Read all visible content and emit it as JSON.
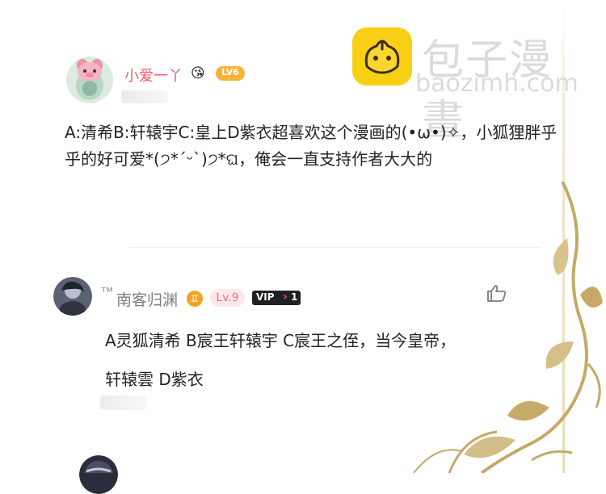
{
  "watermark": {
    "name": "包子漫畫",
    "domain": "baozimh.com"
  },
  "comments": [
    {
      "username": "小爱一丫",
      "emoji": "😘",
      "level_badge": "LV6",
      "text": "A:清希B:轩辕宇C:皇上D紫衣超喜欢这个漫画的(•ω•)✧，小狐狸胖乎乎的好可爱*(੭*ˊᵕˋ)੭*ଘ，俺会一直支持作者大大的"
    },
    {
      "name_prefix": "ᴛᴍ",
      "username": "南客归渊",
      "zodiac": "♊",
      "level_badge": "Lv.9",
      "vip": {
        "label": "VIP",
        "level": "1"
      },
      "text_lines": [
        "A灵狐清希 B宸王轩辕宇 C宸王之侄，当今皇帝，",
        "轩辕雲 D紫衣"
      ],
      "like_icon": "thumbs-up-outline"
    }
  ],
  "colors": {
    "pink_username": "#ef5b6c",
    "gold_ornament": "#c6a967",
    "brand_yellow": "#f9cf16"
  }
}
